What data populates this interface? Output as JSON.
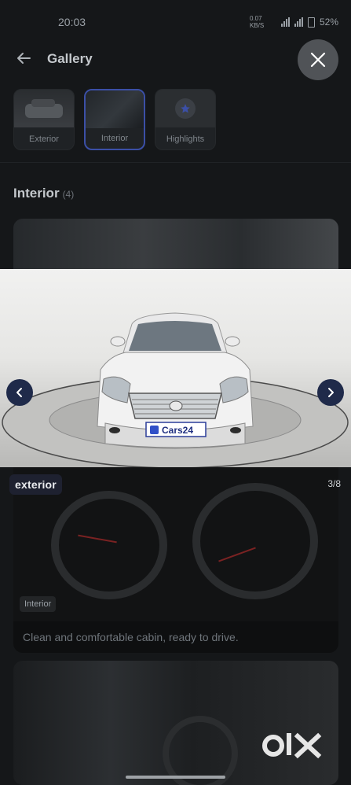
{
  "status_bar": {
    "time": "20:03",
    "data_speed": "0.07 KB/S",
    "battery": "52%"
  },
  "header": {
    "title": "Gallery"
  },
  "tabs": [
    {
      "label": "Exterior",
      "active": false
    },
    {
      "label": "Interior",
      "active": true
    },
    {
      "label": "Highlights",
      "active": false
    }
  ],
  "section": {
    "title": "Interior",
    "count": "(4)"
  },
  "cards": [
    {
      "badge": "Interior",
      "caption": "Clean and comfortable cabin, ready to drive."
    }
  ],
  "viewer": {
    "label": "exterior",
    "counter": "3/8",
    "plate_text": "Cars24"
  },
  "watermark": {
    "text": "OLX"
  },
  "colors": {
    "accent": "#3b4fa6",
    "nav_button": "#1f2a4a",
    "background": "#151719"
  },
  "icons": {
    "back": "arrow-left-icon",
    "close": "close-icon",
    "prev": "chevron-left-icon",
    "next": "chevron-right-icon",
    "highlights": "star-icon"
  }
}
